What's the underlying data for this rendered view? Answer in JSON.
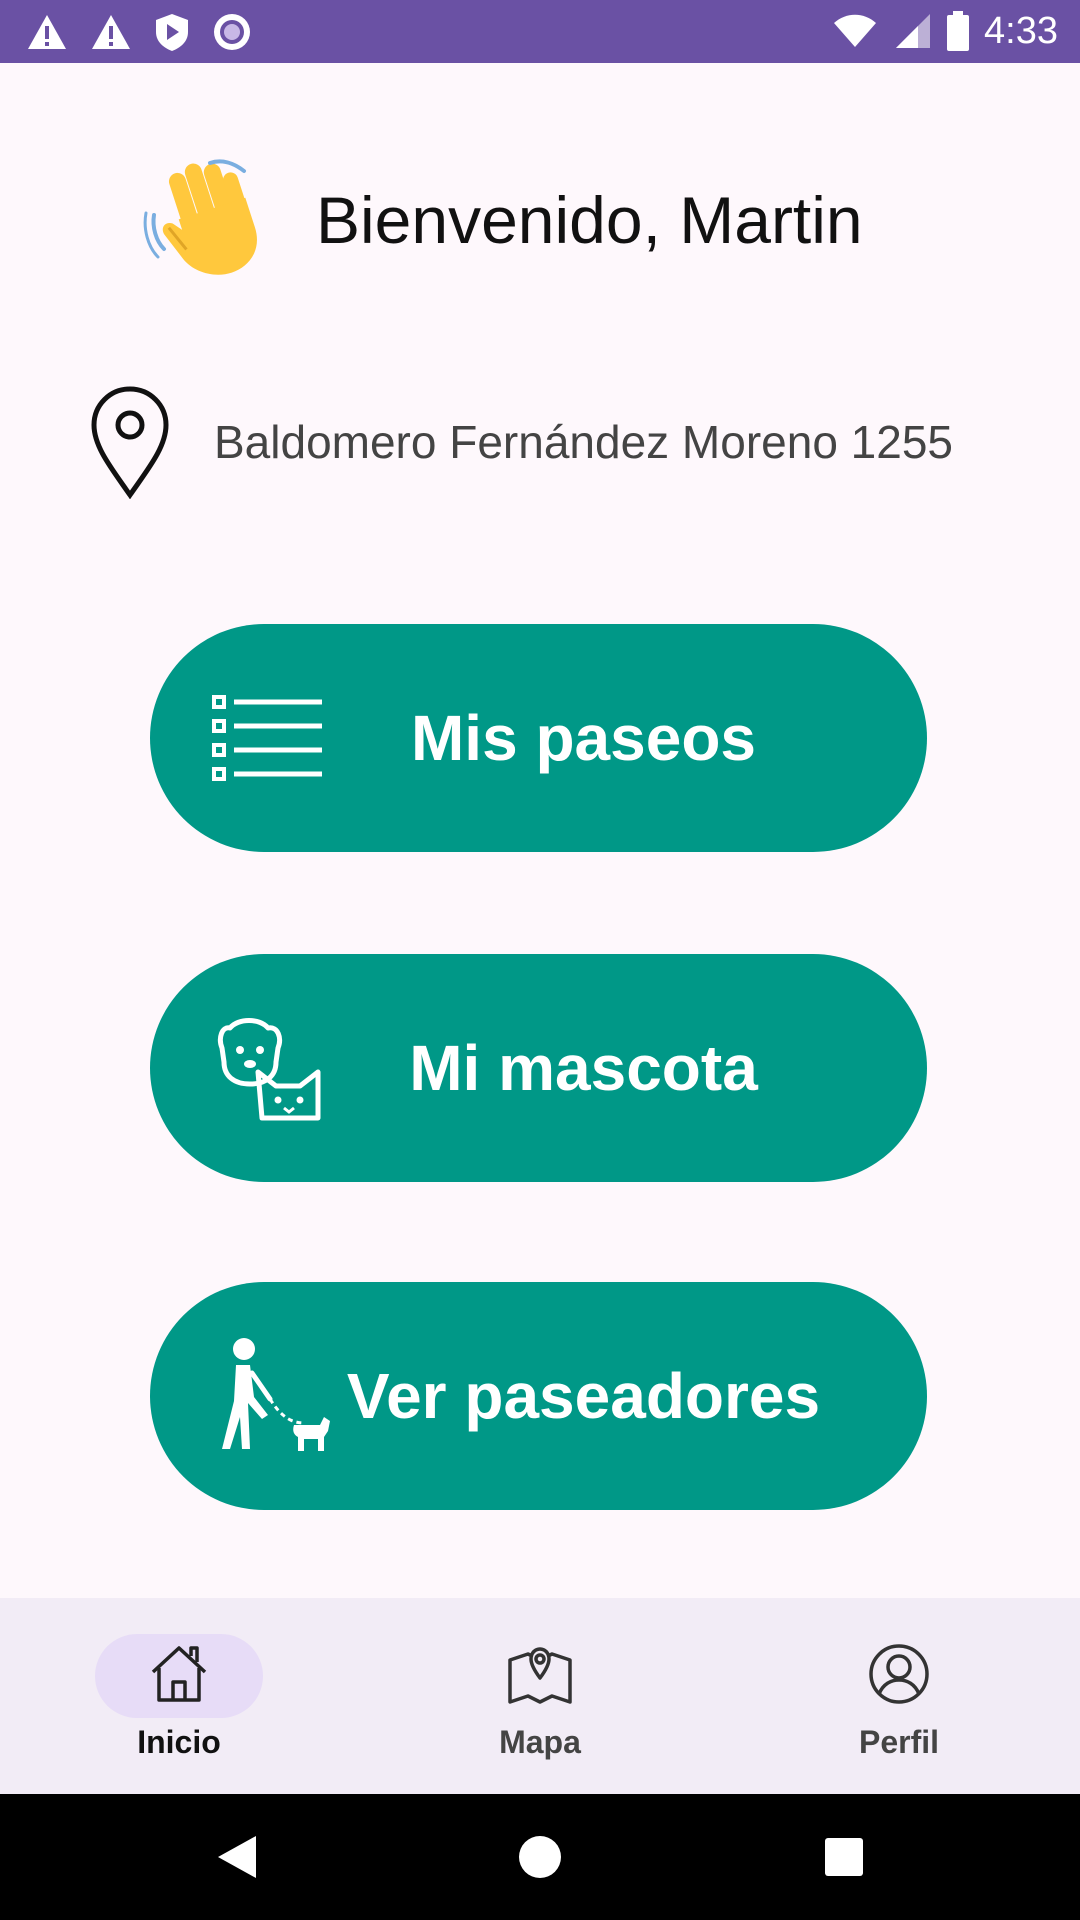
{
  "status_bar": {
    "time": "4:33",
    "icons": [
      "warning-icon",
      "warning-icon",
      "shield-icon",
      "circle-icon",
      "wifi-icon",
      "signal-icon",
      "battery-icon"
    ]
  },
  "greeting": {
    "emoji": "waving-hand-icon",
    "text": "Bienvenido, Martin"
  },
  "location": {
    "icon": "location-pin-icon",
    "address": "Baldomero Fernández Moreno 1255"
  },
  "actions": [
    {
      "label": "Mis paseos",
      "icon": "list-icon"
    },
    {
      "label": "Mi mascota",
      "icon": "pets-icon"
    },
    {
      "label": "Ver paseadores",
      "icon": "dog-walker-icon"
    }
  ],
  "bottom_nav": {
    "items": [
      {
        "label": "Inicio",
        "icon": "home-icon",
        "active": true
      },
      {
        "label": "Mapa",
        "icon": "map-icon",
        "active": false
      },
      {
        "label": "Perfil",
        "icon": "profile-icon",
        "active": false
      }
    ]
  },
  "system_nav": [
    "back-icon",
    "home-circle-icon",
    "recents-icon"
  ],
  "colors": {
    "status_bar": "#6A51A4",
    "accent": "#009887",
    "background": "#FEF8FC",
    "nav_bar": "#F2ECF6",
    "nav_active_pill": "#E7DCF7"
  }
}
